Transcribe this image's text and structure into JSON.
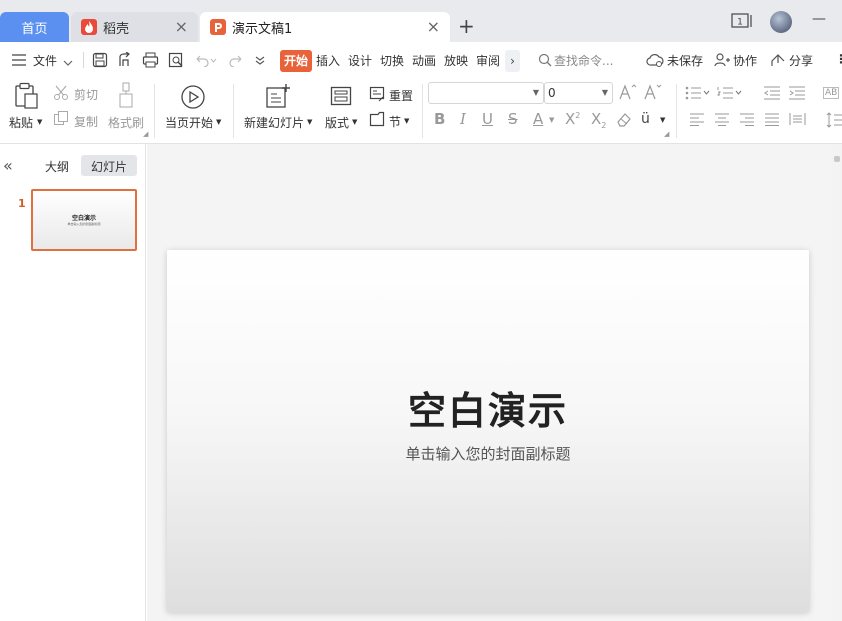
{
  "tabs": {
    "home": "首页",
    "docer": "稻壳",
    "doc": "演示文稿1",
    "add": "+",
    "close": "×"
  },
  "titlebar": {
    "window_badge": "1",
    "minimize": "—"
  },
  "menu": {
    "file": "文件",
    "items": [
      "开始",
      "插入",
      "设计",
      "切换",
      "动画",
      "放映",
      "审阅"
    ],
    "more": "›",
    "search_placeholder": "查找命令...",
    "unsaved": "未保存",
    "collab": "协作",
    "share": "分享",
    "overflow": "⋮"
  },
  "ribbon": {
    "paste": "粘贴",
    "cut": "剪切",
    "copy": "复制",
    "format_painter": "格式刷",
    "from_start": "当页开始",
    "new_slide": "新建幻灯片",
    "layout": "版式",
    "reset": "重置",
    "section": "节",
    "font_name": "",
    "font_size": "0",
    "text_box_label": "AB"
  },
  "leftpane": {
    "collapse": "«",
    "outline_tab": "大纲",
    "slides_tab": "幻灯片",
    "slide_number": "1",
    "thumb_title": "空白演示",
    "thumb_sub": "单击输入您的封面副标题"
  },
  "slide": {
    "title": "空白演示",
    "subtitle": "单击输入您的封面副标题"
  },
  "colors": {
    "accent": "#e8633a",
    "home_tab": "#5b8ff0",
    "tabbar": "#e9eaee",
    "docer_icon": "#e84a3c",
    "ppt_icon": "#e8633a"
  }
}
